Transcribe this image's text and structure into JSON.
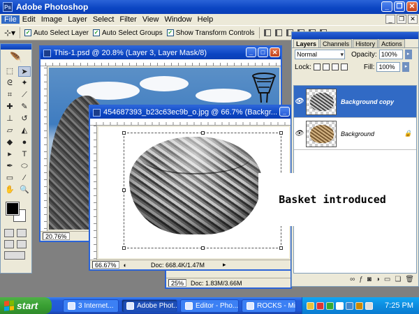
{
  "app": {
    "title": "Adobe Photoshop"
  },
  "menu": [
    "File",
    "Edit",
    "Image",
    "Layer",
    "Select",
    "Filter",
    "View",
    "Window",
    "Help"
  ],
  "options": {
    "auto_select_layer": "Auto Select Layer",
    "auto_select_groups": "Auto Select Groups",
    "show_transform_controls": "Show Transform Controls"
  },
  "doc1": {
    "title": "This-1.psd @ 20.8% (Layer 3, Layer Mask/8)",
    "zoom": "20.76%"
  },
  "doc2": {
    "title": "454687393_b23c63ec9b_o.jpg @ 66.7% (Backgr...",
    "zoom": "66.67%",
    "doc_size": "Doc: 668.4K/1.47M"
  },
  "doc3": {
    "zoom": "25%",
    "doc_size": "Doc: 1.83M/3.66M"
  },
  "layers_panel": {
    "tabs": [
      "Layers",
      "Channels",
      "History",
      "Actions"
    ],
    "blend_mode": "Normal",
    "opacity_label": "Opacity:",
    "opacity": "100%",
    "lock_label": "Lock:",
    "fill_label": "Fill:",
    "fill": "100%",
    "layers": [
      {
        "name": "Background copy",
        "selected": true
      },
      {
        "name": "Background",
        "selected": false
      }
    ]
  },
  "annotation": "Basket introduced",
  "taskbar": {
    "start": "start",
    "items": [
      "3 Internet...",
      "Adobe Phot...",
      "Editor - Pho...",
      "ROCKS - Mi..."
    ],
    "clock": "7:25 PM"
  },
  "colors": {
    "titlebar": "#0a44c2",
    "selection": "#316ac5",
    "taskbar": "#245edb",
    "start": "#39a033"
  }
}
